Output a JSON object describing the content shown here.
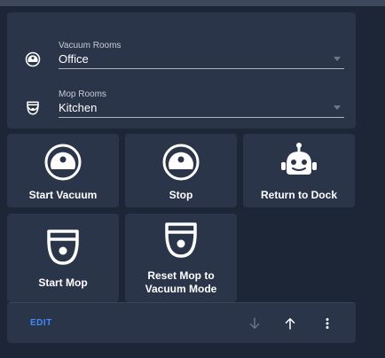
{
  "entities": {
    "vacuum_rooms": {
      "label": "Vacuum Rooms",
      "value": "Office"
    },
    "mop_rooms": {
      "label": "Mop Rooms",
      "value": "Kitchen"
    }
  },
  "buttons": {
    "start_vacuum": "Start Vacuum",
    "stop": "Stop",
    "return_to_dock": "Return to Dock",
    "start_mop": "Start Mop",
    "reset_mop_line1": "Reset Mop to",
    "reset_mop_line2": "Vacuum Mode"
  },
  "footer": {
    "edit_label": "EDIT"
  },
  "icons": {
    "vacuum": "robot-vacuum-icon",
    "mop": "robot-mop-icon",
    "dock": "robot-face-icon",
    "down": "arrow-down-icon",
    "up": "arrow-up-icon",
    "menu": "dots-vertical-icon"
  },
  "colors": {
    "background": "#1d2637",
    "card": "#2b3549",
    "accent": "#3d8bfd",
    "text": "#ffffff"
  }
}
